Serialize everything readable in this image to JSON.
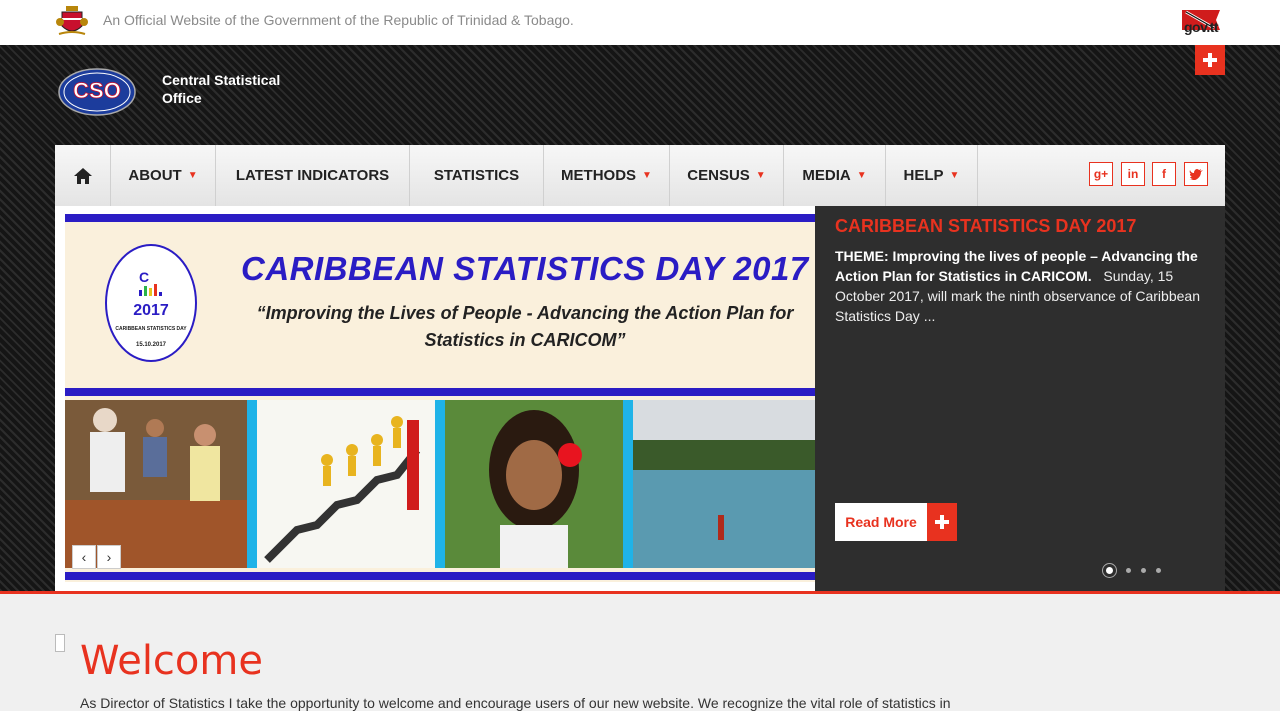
{
  "topbar": {
    "official_text": "An Official Website of the Government of the Republic of Trinidad & Tobago.",
    "gov_logo_text": "gov.tt"
  },
  "site": {
    "name": "Central Statistical Office",
    "logo_text": "CSO"
  },
  "nav": {
    "items": [
      {
        "label": "ABOUT",
        "dropdown": true
      },
      {
        "label": "LATEST INDICATORS",
        "dropdown": false
      },
      {
        "label": "STATISTICS",
        "dropdown": false
      },
      {
        "label": "METHODS",
        "dropdown": true
      },
      {
        "label": "CENSUS",
        "dropdown": true
      },
      {
        "label": "MEDIA",
        "dropdown": true
      },
      {
        "label": "HELP",
        "dropdown": true
      }
    ],
    "social": [
      "google-plus-icon",
      "linkedin-icon",
      "facebook-icon",
      "twitter-icon"
    ]
  },
  "slide": {
    "title": "CARIBBEAN STATISTICS DAY 2017",
    "subtitle": "“Improving the Lives of People - Advancing the Action Plan for Statistics in CARICOM”",
    "badge_year": "2017",
    "badge_caption": "CARIBBEAN STATISTICS DAY",
    "badge_date": "15.10.2017"
  },
  "panel": {
    "title": "CARIBBEAN STATISTICS DAY 2017",
    "theme_bold": "THEME: Improving the lives of people – Advancing the Action Plan for Statistics in CARICOM.",
    "body": "Sunday, 15 October 2017, will mark the ninth observance of Caribbean Statistics Day ...",
    "read_more": "Read More"
  },
  "welcome": {
    "title": "Welcome",
    "text": "As Director of Statistics I take the opportunity to welcome and encourage users of our new website. We recognize the vital role of statistics in"
  },
  "colors": {
    "accent": "#e8321f",
    "slide_blue": "#2a1cc4",
    "panel_bg": "#2e2e2e"
  }
}
